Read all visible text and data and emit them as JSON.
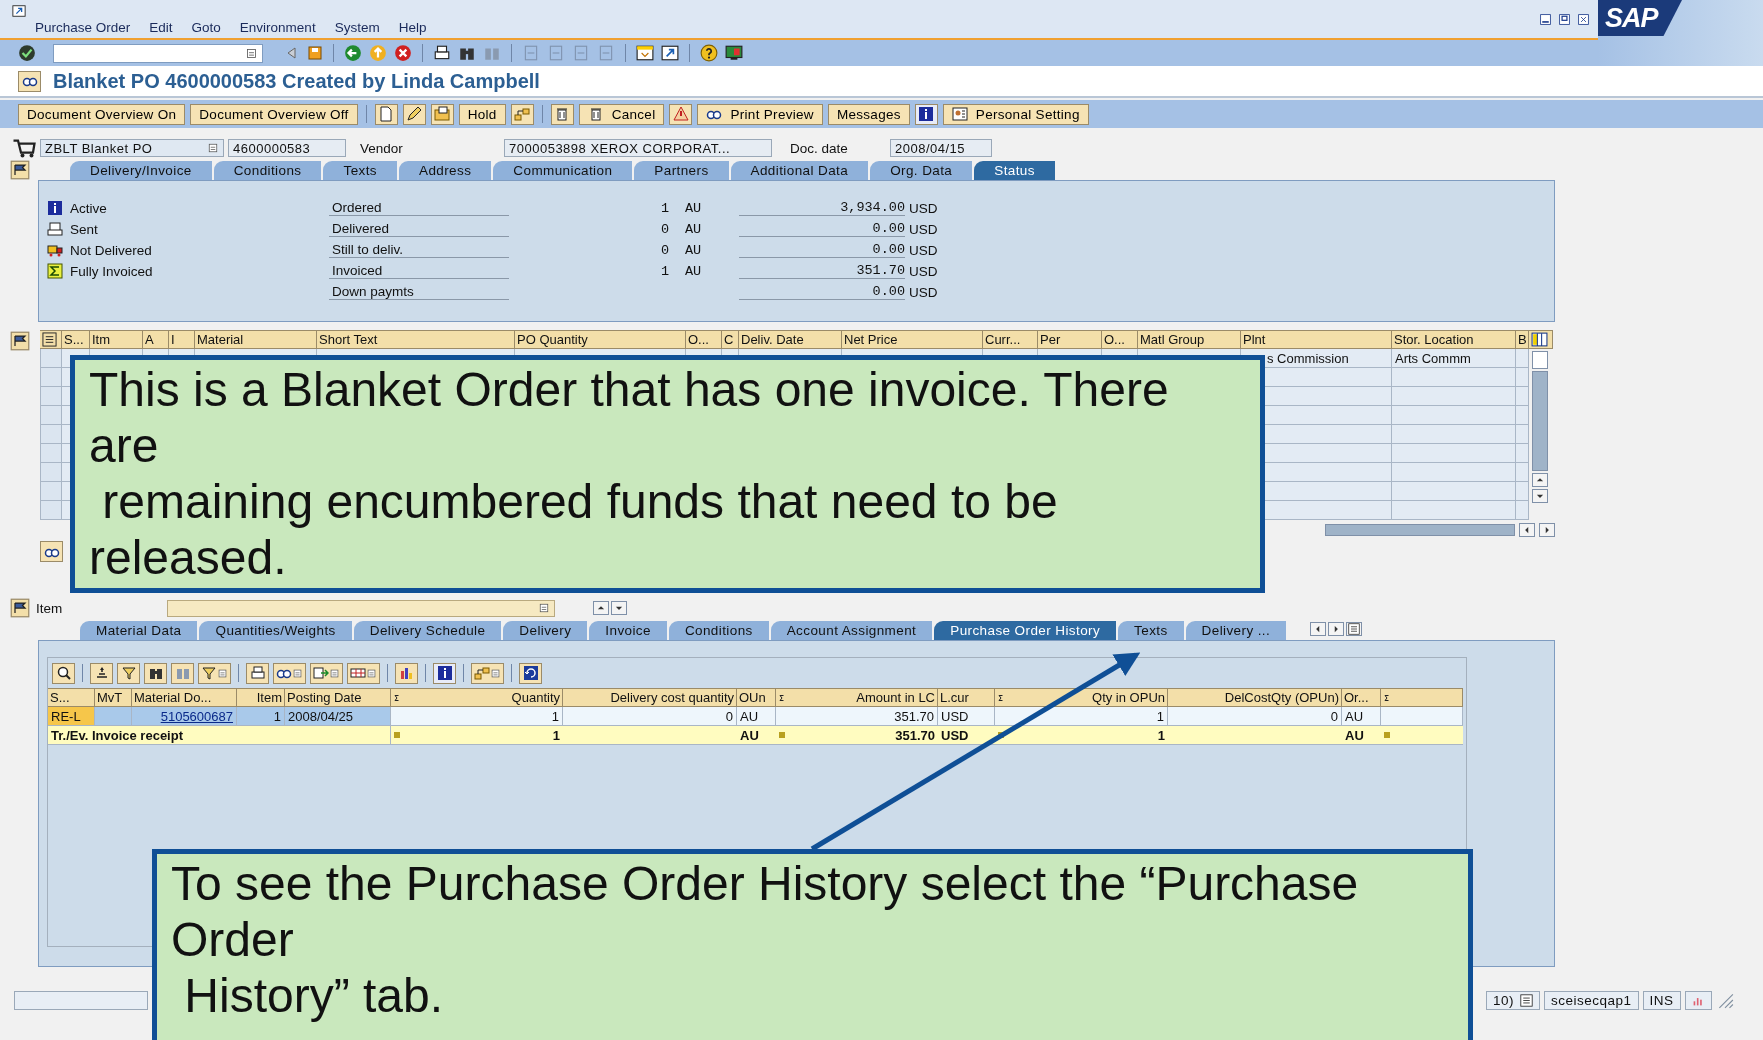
{
  "menu_bar": [
    "Purchase Order",
    "Edit",
    "Goto",
    "Environment",
    "System",
    "Help"
  ],
  "logo": "SAP",
  "title": "Blanket PO 4600000583 Created by Linda Campbell",
  "app_toolbar": [
    "Document Overview On",
    "Document Overview Off",
    "Hold",
    "Cancel",
    "Print Preview",
    "Messages",
    "Personal Setting"
  ],
  "header": {
    "doc_type": "ZBLT Blanket PO",
    "po_number": "4600000583",
    "vendor_label": "Vendor",
    "vendor": "7000053898 XEROX CORPORAT...",
    "doc_date_label": "Doc. date",
    "doc_date": "2008/04/15"
  },
  "header_tabs": [
    {
      "label": "Delivery/Invoice",
      "selected": false
    },
    {
      "label": "Conditions",
      "selected": false
    },
    {
      "label": "Texts",
      "selected": false
    },
    {
      "label": "Address",
      "selected": false
    },
    {
      "label": "Communication",
      "selected": false
    },
    {
      "label": "Partners",
      "selected": false
    },
    {
      "label": "Additional Data",
      "selected": false
    },
    {
      "label": "Org. Data",
      "selected": false
    },
    {
      "label": "Status",
      "selected": true
    }
  ],
  "status": {
    "states": [
      "Active",
      "Sent",
      "Not Delivered",
      "Fully Invoiced"
    ],
    "rows": [
      {
        "label": "Ordered",
        "qty": "1",
        "unit": "AU",
        "amount": "3,934.00",
        "currency": "USD"
      },
      {
        "label": "Delivered",
        "qty": "0",
        "unit": "AU",
        "amount": "0.00",
        "currency": "USD"
      },
      {
        "label": "Still to deliv.",
        "qty": "0",
        "unit": "AU",
        "amount": "0.00",
        "currency": "USD"
      },
      {
        "label": "Invoiced",
        "qty": "1",
        "unit": "AU",
        "amount": "351.70",
        "currency": "USD"
      },
      {
        "label": "Down paymts",
        "amount": "0.00",
        "currency": "USD"
      }
    ]
  },
  "items_table": {
    "columns": [
      "S...",
      "Itm",
      "A",
      "I",
      "Material",
      "Short Text",
      "PO Quantity",
      "O...",
      "C",
      "Deliv. Date",
      "Net Price",
      "Curr...",
      "Per",
      "O...",
      "Matl Group",
      "Plnt",
      "Stor. Location",
      "B"
    ],
    "rows": [
      {
        "plnt": "s Commission",
        "stor_location": "Arts Commm"
      }
    ]
  },
  "item_label": "Item",
  "item_tabs": [
    {
      "label": "Material Data",
      "selected": false
    },
    {
      "label": "Quantities/Weights",
      "selected": false
    },
    {
      "label": "Delivery Schedule",
      "selected": false
    },
    {
      "label": "Delivery",
      "selected": false
    },
    {
      "label": "Invoice",
      "selected": false
    },
    {
      "label": "Conditions",
      "selected": false
    },
    {
      "label": "Account Assignment",
      "selected": false
    },
    {
      "label": "Purchase Order History",
      "selected": true
    },
    {
      "label": "Texts",
      "selected": false
    },
    {
      "label": "Delivery ...",
      "selected": false
    }
  ],
  "history_table": {
    "columns": [
      {
        "label": "S...",
        "sum": false
      },
      {
        "label": "MvT",
        "sum": false
      },
      {
        "label": "Material Do...",
        "sum": false
      },
      {
        "label": "Item",
        "sum": false
      },
      {
        "label": "Posting Date",
        "sum": false
      },
      {
        "label": "Quantity",
        "sum": true
      },
      {
        "label": "Delivery cost quantity",
        "sum": false
      },
      {
        "label": "OUn",
        "sum": false
      },
      {
        "label": "Amount in LC",
        "sum": true
      },
      {
        "label": "L.cur",
        "sum": false
      },
      {
        "label": "Qty in OPUn",
        "sum": true
      },
      {
        "label": "DelCostQty (OPUn)",
        "sum": false
      },
      {
        "label": "Or...",
        "sum": false
      },
      {
        "sum": true
      }
    ],
    "rows": [
      {
        "s": "RE-L",
        "material_doc": "5105600687",
        "item": "1",
        "posting_date": "2008/04/25",
        "quantity": "1",
        "delivery_cost_quantity": "0",
        "oun": "AU",
        "amount_in_lc": "351.70",
        "l_cur": "USD",
        "qty_in_opun": "1",
        "delcostqty_opun": "0",
        "or": "AU"
      }
    ],
    "total": {
      "label": "Tr./Ev. Invoice receipt",
      "quantity": "1",
      "oun": "AU",
      "amount_in_lc": "351.70",
      "l_cur": "USD",
      "qty_in_opun": "1",
      "or": "AU"
    }
  },
  "status_bar": {
    "system": "10)",
    "user": "sceisecqap1",
    "mode": "INS"
  },
  "callouts": [
    {
      "text": "This is a Blanket Order that has one invoice. There are\n remaining encumbered funds that need to be released."
    },
    {
      "text": "To see the Purchase Order History select the “Purchase Order\n History” tab."
    }
  ]
}
